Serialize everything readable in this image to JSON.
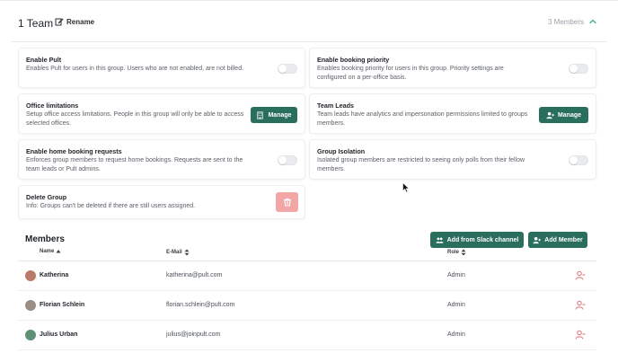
{
  "header": {
    "team_title": "1 Team",
    "rename_label": "Rename",
    "members_count": "3 Members"
  },
  "settings": {
    "enable_pult": {
      "title": "Enable Pult",
      "description": "Enables Pult for users in this group. Users who are not enabled, are not billed.",
      "enabled": false
    },
    "enable_booking_priority": {
      "title": "Enable booking priority",
      "description": "Enables booking priority for users in this group. Priority settings are configured on a per-office basis.",
      "enabled": false
    },
    "office_limitations": {
      "title": "Office limitations",
      "description": "Setup office access limitations. People in this group will only be able to access selected offices.",
      "button_label": "Manage"
    },
    "team_leads": {
      "title": "Team Leads",
      "description": "Team leads have analytics and impersonation permissions limited to groups members.",
      "button_label": "Manage"
    },
    "home_booking": {
      "title": "Enable home booking requests",
      "description": "Enforces group members to request home bookings. Requests are sent to the team leads or Pult admins.",
      "enabled": false
    },
    "group_isolation": {
      "title": "Group Isolation",
      "description": "Isolated group members are restricted to seeing only polls from their fellow members.",
      "enabled": false
    },
    "delete_group": {
      "title": "Delete Group",
      "description": "Info: Groups can't be deleted if there are still users assigned."
    }
  },
  "members": {
    "title": "Members",
    "add_slack_label": "Add from Slack channel",
    "add_member_label": "Add Member",
    "columns": {
      "name": "Name",
      "email": "E-Mail",
      "role": "Role"
    },
    "rows": [
      {
        "name": "Katherina",
        "email": "katherina@pult.com",
        "role": "Admin",
        "avatar_color": "#b97a6a"
      },
      {
        "name": "Florian Schlein",
        "email": "florian.schlein@pult.com",
        "role": "Admin",
        "avatar_color": "#9a8f86"
      },
      {
        "name": "Julius Urban",
        "email": "julius@joinpult.com",
        "role": "Admin",
        "avatar_color": "#5f8f74"
      }
    ]
  },
  "colors": {
    "accent_green": "#2a6e5e",
    "danger_light": "#f2a6a6",
    "danger": "#e36a6a",
    "chevron_teal": "#3aa99a"
  }
}
